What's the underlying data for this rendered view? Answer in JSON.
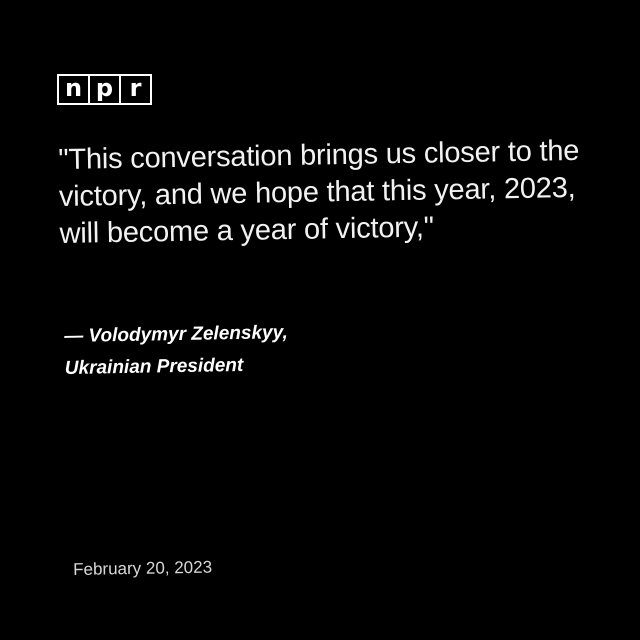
{
  "logo": {
    "letters": [
      "n",
      "p",
      "r"
    ]
  },
  "quote": {
    "text": "\"This conversation brings us closer to the victory, and we hope that this year, 2023, will become a year of victory,\""
  },
  "attribution": {
    "line1": "— Volodymyr Zelenskyy,",
    "line2": "Ukrainian President"
  },
  "date": "February 20, 2023",
  "colors": {
    "background": "#000000",
    "text": "#ffffff"
  }
}
